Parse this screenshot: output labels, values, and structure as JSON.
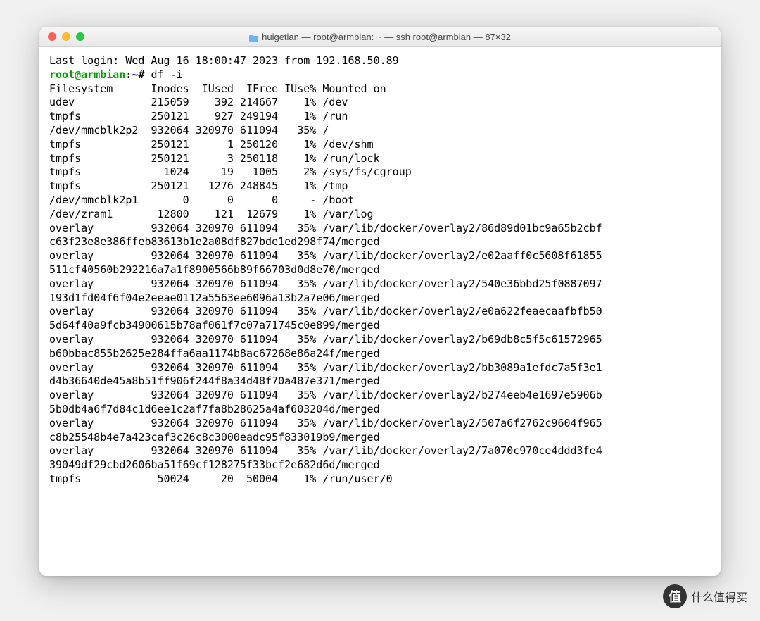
{
  "window": {
    "title": "huigetian — root@armbian: ~ — ssh root@armbian — 87×32"
  },
  "login_line": "Last login: Wed Aug 16 18:00:47 2023 from 192.168.50.89",
  "prompt": {
    "user_host": "root@armbian",
    "sep": ":",
    "path": "~",
    "hash": "#",
    "command": "df -i"
  },
  "header": "Filesystem      Inodes  IUsed  IFree IUse% Mounted on",
  "rows": [
    "udev            215059    392 214667    1% /dev",
    "tmpfs           250121    927 249194    1% /run",
    "/dev/mmcblk2p2  932064 320970 611094   35% /",
    "tmpfs           250121      1 250120    1% /dev/shm",
    "tmpfs           250121      3 250118    1% /run/lock",
    "tmpfs             1024     19   1005    2% /sys/fs/cgroup",
    "tmpfs           250121   1276 248845    1% /tmp",
    "/dev/mmcblk2p1       0      0      0     - /boot",
    "/dev/zram1       12800    121  12679    1% /var/log",
    "overlay         932064 320970 611094   35% /var/lib/docker/overlay2/86d89d01bc9a65b2cbfc63f23e8e386ffeb83613b1e2a08df827bde1ed298f74/merged",
    "overlay         932064 320970 611094   35% /var/lib/docker/overlay2/e02aaff0c5608f61855511cf40560b292216a7a1f8900566b89f66703d0d8e70/merged",
    "overlay         932064 320970 611094   35% /var/lib/docker/overlay2/540e36bbd25f0887097193d1fd04f6f04e2eeae0112a5563ee6096a13b2a7e06/merged",
    "overlay         932064 320970 611094   35% /var/lib/docker/overlay2/e0a622feaecaafbfb505d64f40a9fcb34900615b78af061f7c07a71745c0e899/merged",
    "overlay         932064 320970 611094   35% /var/lib/docker/overlay2/b69db8c5f5c61572965b60bbac855b2625e284ffa6aa1174b8ac67268e86a24f/merged",
    "overlay         932064 320970 611094   35% /var/lib/docker/overlay2/bb3089a1efdc7a5f3e1d4b36640de45a8b51ff906f244f8a34d48f70a487e371/merged",
    "overlay         932064 320970 611094   35% /var/lib/docker/overlay2/b274eeb4e1697e5906b5b0db4a6f7d84c1d6ee1c2af7fa8b28625a4af603204d/merged",
    "overlay         932064 320970 611094   35% /var/lib/docker/overlay2/507a6f2762c9604f965c8b25548b4e7a423caf3c26c8c3000eadc95f833019b9/merged",
    "overlay         932064 320970 611094   35% /var/lib/docker/overlay2/7a070c970ce4ddd3fe439049df29cbd2606ba51f69cf128275f33bcf2e682d6d/merged",
    "tmpfs            50024     20  50004    1% /run/user/0"
  ],
  "watermark": {
    "badge": "值",
    "text": "什么值得买"
  }
}
